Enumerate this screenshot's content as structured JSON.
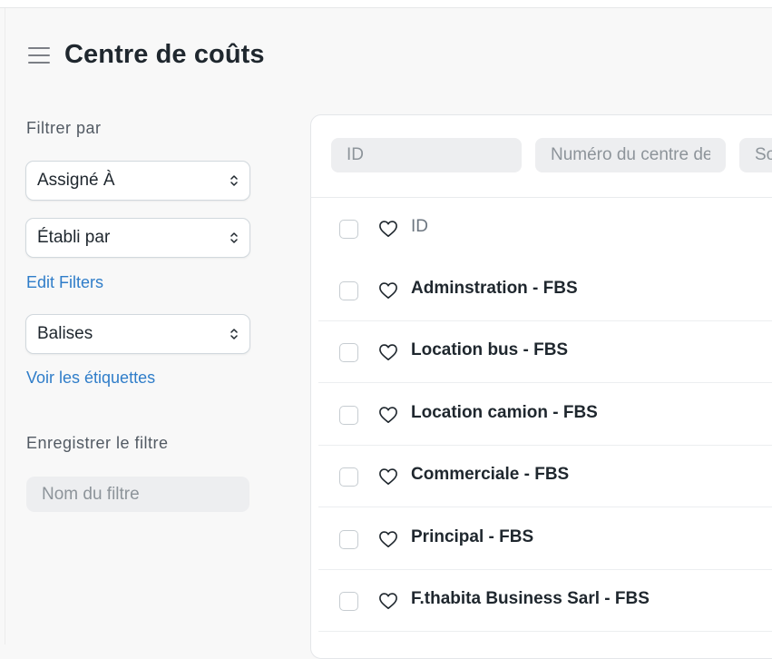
{
  "page": {
    "title": "Centre de coûts",
    "menu_icon": "hamburger-menu-icon"
  },
  "sidebar": {
    "filter_by_label": "Filtrer par",
    "assigned_to": "Assigné À",
    "created_by": "Établi par",
    "edit_filters": "Edit Filters",
    "tags": "Balises",
    "show_tags": "Voir les étiquettes",
    "save_filter_label": "Enregistrer le filtre",
    "filter_name_placeholder": "Nom du filtre"
  },
  "list": {
    "search": {
      "id_placeholder": "ID",
      "cost_center_number_placeholder": "Numéro du centre de coûts",
      "third_placeholder": "Société"
    },
    "header_label": "ID",
    "rows": [
      {
        "label": "Adminstration - FBS"
      },
      {
        "label": "Location bus - FBS"
      },
      {
        "label": "Location camion - FBS"
      },
      {
        "label": "Commerciale - FBS"
      },
      {
        "label": "Principal - FBS"
      },
      {
        "label": "F.thabita Business Sarl - FBS"
      }
    ]
  },
  "colors": {
    "background": "#f8f8f8",
    "link": "#2f7dc9",
    "text": "#1f272e",
    "muted": "#8d949a"
  }
}
